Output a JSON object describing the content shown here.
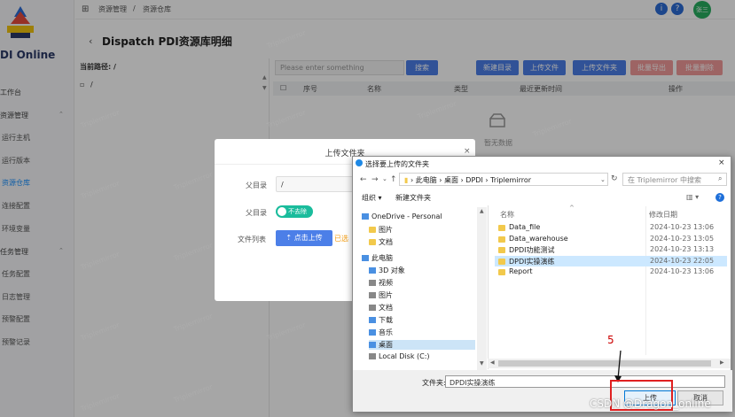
{
  "sidebar": {
    "logo_text": "DI Online",
    "items": [
      {
        "label": "工作台",
        "sub": false,
        "active": false
      },
      {
        "label": "资源管理",
        "sub": false,
        "active": false,
        "expanded": true
      },
      {
        "label": "运行主机",
        "sub": true,
        "active": false
      },
      {
        "label": "运行版本",
        "sub": true,
        "active": false
      },
      {
        "label": "资源仓库",
        "sub": true,
        "active": true
      },
      {
        "label": "连接配置",
        "sub": true,
        "active": false
      },
      {
        "label": "环境变量",
        "sub": true,
        "active": false
      },
      {
        "label": "任务管理",
        "sub": false,
        "active": false,
        "expanded": true
      },
      {
        "label": "任务配置",
        "sub": true,
        "active": false
      },
      {
        "label": "日志管理",
        "sub": true,
        "active": false
      },
      {
        "label": "预警配置",
        "sub": true,
        "active": false
      },
      {
        "label": "预警记录",
        "sub": true,
        "active": false
      }
    ]
  },
  "topbar": {
    "breadcrumb_1": "资源管理",
    "breadcrumb_sep": "/",
    "breadcrumb_2": "资源仓库",
    "avatar_text": "张三"
  },
  "page": {
    "title": "Dispatch PDI资源库明细",
    "current_path_label": "当前路径: /",
    "tree_root": "/"
  },
  "toolbar": {
    "search_placeholder": "Please enter something",
    "search_button": "搜索",
    "new_dir": "新建目录",
    "upload_file": "上传文件",
    "upload_folder": "上传文件夹",
    "batch_download": "批量导出",
    "batch_delete": "批量删除"
  },
  "table": {
    "headers": [
      "序号",
      "名称",
      "类型",
      "最近更新时间",
      "操作"
    ],
    "empty_text": "暂无数据"
  },
  "watermark": "Triplemirror",
  "upload_dialog": {
    "title": "上传文件夹",
    "close": "×",
    "parent_dir_label": "父目录",
    "parent_dir_value": "/",
    "overwrite_label": "父目录",
    "toggle_label": "不去除",
    "file_list_label": "文件列表",
    "upload_button": "点击上传",
    "status_text": "已选"
  },
  "file_dialog": {
    "title": "选择要上传的文件夹",
    "close": "×",
    "address": [
      "此电脑",
      "桌面",
      "DPDI",
      "Triplemirror"
    ],
    "search_placeholder": "在 Triplemirror 中搜索",
    "organize": "组织 ▾",
    "new_folder": "新建文件夹",
    "nav_items": [
      {
        "label": "OneDrive - Personal",
        "icon": "cloud-icon",
        "indent": 0
      },
      {
        "label": "图片",
        "icon": "folder-icon",
        "indent": 1
      },
      {
        "label": "文档",
        "icon": "folder-icon",
        "indent": 1
      },
      {
        "label": "此电脑",
        "icon": "computer-icon",
        "indent": 0
      },
      {
        "label": "3D 对象",
        "icon": "cube-icon",
        "indent": 1
      },
      {
        "label": "视频",
        "icon": "video-icon",
        "indent": 1
      },
      {
        "label": "图片",
        "icon": "picture-icon",
        "indent": 1
      },
      {
        "label": "文档",
        "icon": "document-icon",
        "indent": 1
      },
      {
        "label": "下载",
        "icon": "download-icon",
        "indent": 1
      },
      {
        "label": "音乐",
        "icon": "music-icon",
        "indent": 1
      },
      {
        "label": "桌面",
        "icon": "desktop-icon",
        "indent": 1
      },
      {
        "label": "Local Disk (C:)",
        "icon": "disk-icon",
        "indent": 1
      }
    ],
    "col_name": "名称",
    "col_date": "修改日期",
    "files": [
      {
        "name": "Data_file",
        "date": "2024-10-23 13:06"
      },
      {
        "name": "Data_warehouse",
        "date": "2024-10-23 13:05"
      },
      {
        "name": "DPDI功能测试",
        "date": "2024-10-23 13:13"
      },
      {
        "name": "DPDI实操演练",
        "date": "2024-10-23 22:05"
      },
      {
        "name": "Report",
        "date": "2024-10-23 13:06"
      }
    ],
    "selected_index": 3,
    "folder_label": "文件夹:",
    "folder_value": "DPDI实操演练",
    "upload_button": "上传",
    "cancel_button": "取消"
  },
  "annotation": {
    "step_number": "5"
  },
  "credit": "CSDN @Dragon_online",
  "colors": {
    "accent": "#4c7fe8",
    "danger": "#f19a9a",
    "toggle": "#1abc9c",
    "highlight_box": "#e02020"
  }
}
